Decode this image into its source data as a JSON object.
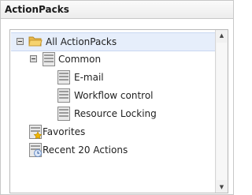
{
  "panel": {
    "title": "ActionPacks"
  },
  "tree": {
    "items": [
      {
        "label": "All ActionPacks",
        "icon": "open-folder-icon",
        "expanded": true,
        "selected": true
      },
      {
        "label": "Common",
        "icon": "list-icon",
        "expanded": true
      },
      {
        "label": "E-mail",
        "icon": "list-icon"
      },
      {
        "label": "Workflow control",
        "icon": "list-icon"
      },
      {
        "label": "Resource Locking",
        "icon": "list-icon"
      },
      {
        "label": "Favorites",
        "icon": "favorites-icon"
      },
      {
        "label": "Recent 20 Actions",
        "icon": "recent-actions-icon"
      }
    ]
  },
  "scrollbar": {
    "up_arrow": "▲",
    "down_arrow": "▼"
  },
  "colors": {
    "selection": "#e6eefb",
    "folder": "#f4c95d",
    "star": "#f0b400",
    "clock": "#6a8fc7"
  }
}
